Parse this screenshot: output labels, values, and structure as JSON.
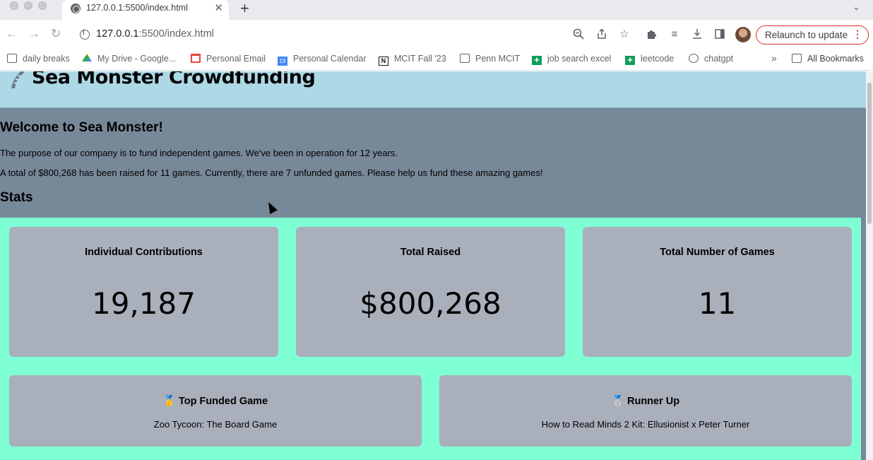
{
  "browser": {
    "tab_title": "127.0.0.1:5500/index.html",
    "url_host": "127.0.0.1",
    "url_path": ":5500/index.html",
    "relaunch_label": "Relaunch to update",
    "bookmarks": [
      {
        "label": "daily breaks",
        "icon": "folder-icon"
      },
      {
        "label": "My Drive - Google...",
        "icon": "google-drive-icon"
      },
      {
        "label": "Personal Email",
        "icon": "gmail-icon"
      },
      {
        "label": "Personal Calendar",
        "icon": "google-calendar-icon"
      },
      {
        "label": "MCIT Fall '23",
        "icon": "notion-icon"
      },
      {
        "label": "Penn MCIT",
        "icon": "folder-icon"
      },
      {
        "label": "job search excel",
        "icon": "google-sheets-icon"
      },
      {
        "label": "leetcode",
        "icon": "google-sheets-icon"
      },
      {
        "label": "chatgpt",
        "icon": "chatgpt-icon"
      }
    ],
    "more_bookmarks": "»",
    "all_bookmarks": "All Bookmarks",
    "calendar_day": "19"
  },
  "page": {
    "site_title": "Sea Monster Crowdfunding",
    "welcome_heading": "Welcome to Sea Monster!",
    "purpose_text": "The purpose of our company is to fund independent games. We've been in operation for 12 years.",
    "summary_text": "A total of $800,268 has been raised for 11 games. Currently, there are 7 unfunded games. Please help us fund these amazing games!",
    "stats_heading": "Stats",
    "stats": [
      {
        "label": "Individual Contributions",
        "value": "19,187"
      },
      {
        "label": "Total Raised",
        "value": "$800,268"
      },
      {
        "label": "Total Number of Games",
        "value": "11"
      }
    ],
    "top_funded": {
      "emoji": "🥇",
      "label": "Top Funded Game",
      "game": "Zoo Tycoon: The Board Game"
    },
    "runner_up": {
      "emoji": "🥈",
      "label": "Runner Up",
      "game": "How to Read Minds 2 Kit: Ellusionist x Peter Turner"
    }
  },
  "colors": {
    "header_bg": "#add8e6",
    "body_bg": "#778899",
    "stats_bg": "#7fffd4",
    "card_bg": "#a9b0bb",
    "relaunch_border": "#d93025"
  }
}
